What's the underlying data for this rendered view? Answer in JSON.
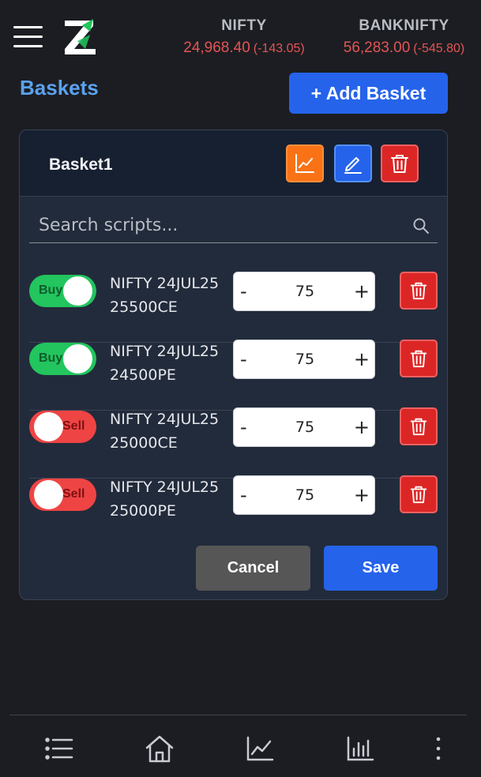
{
  "header": {
    "tickers": [
      {
        "name": "NIFTY",
        "price": "24,968.40",
        "change": "(-143.05)"
      },
      {
        "name": "BANKNIFTY",
        "price": "56,283.00",
        "change": "(-545.80)"
      }
    ],
    "colors": {
      "negative": "#e25555"
    }
  },
  "page": {
    "title": "Baskets",
    "add_button": "+ Add Basket"
  },
  "basket": {
    "name": "Basket1",
    "search_placeholder": "Search scripts...",
    "items": [
      {
        "side": "Buy",
        "line1": "NIFTY 24JUL25",
        "line2": "25500CE",
        "qty": "75"
      },
      {
        "side": "Buy",
        "line1": "NIFTY 24JUL25",
        "line2": "24500PE",
        "qty": "75"
      },
      {
        "side": "Sell",
        "line1": "NIFTY 24JUL25",
        "line2": "25000CE",
        "qty": "75"
      },
      {
        "side": "Sell",
        "line1": "NIFTY 24JUL25",
        "line2": "25000PE",
        "qty": "75"
      }
    ],
    "minus_label": "-",
    "plus_label": "+",
    "cancel_label": "Cancel",
    "save_label": "Save"
  },
  "nav": {
    "icons": [
      "list-icon",
      "home-icon",
      "line-chart-icon",
      "bar-chart-icon",
      "more-vertical-icon"
    ]
  }
}
